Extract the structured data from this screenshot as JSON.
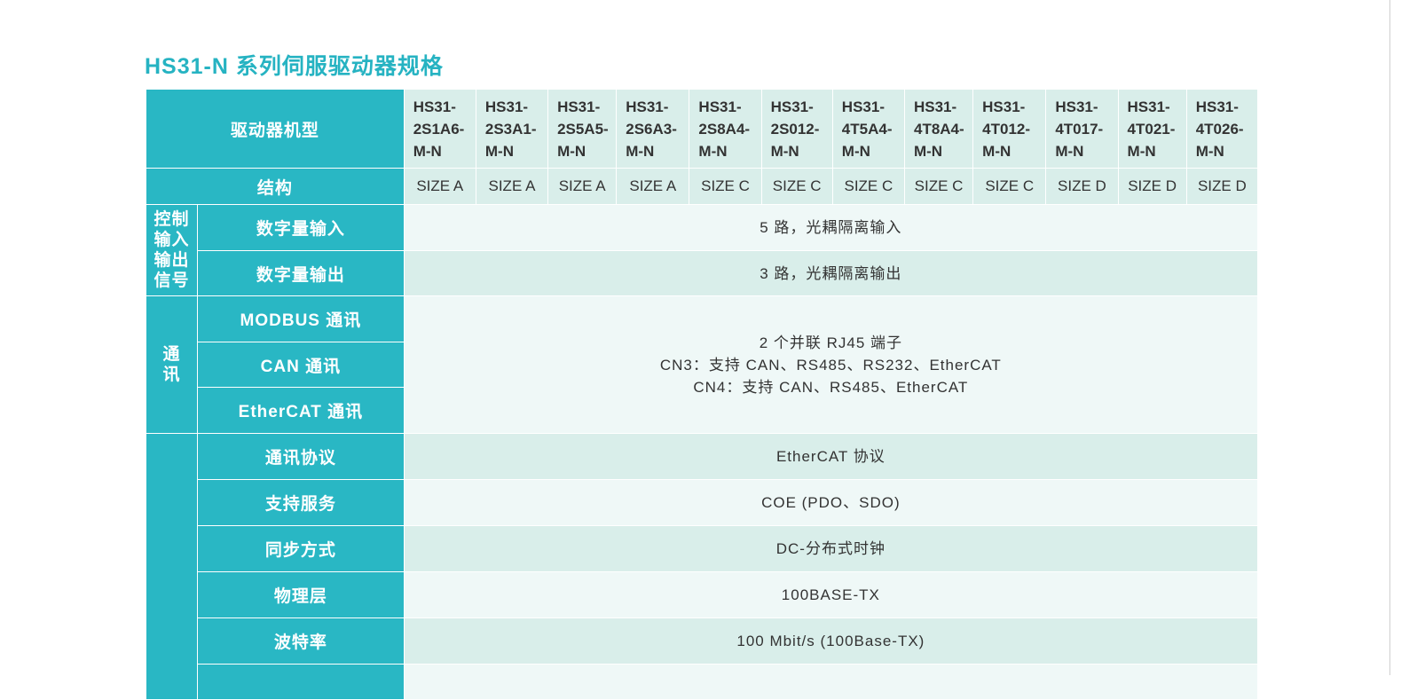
{
  "title": "HS31-N 系列伺服驱动器规格",
  "table": {
    "header_label": "驱动器机型",
    "models": [
      [
        "HS31-",
        "2S1A6-",
        "M-N"
      ],
      [
        "HS31-",
        "2S3A1-",
        "M-N"
      ],
      [
        "HS31-",
        "2S5A5-",
        "M-N"
      ],
      [
        "HS31-",
        "2S6A3-",
        "M-N"
      ],
      [
        "HS31-",
        "2S8A4-",
        "M-N"
      ],
      [
        "HS31-",
        "2S012-",
        "M-N"
      ],
      [
        "HS31-",
        "4T5A4-",
        "M-N"
      ],
      [
        "HS31-",
        "4T8A4-",
        "M-N"
      ],
      [
        "HS31-",
        "4T012-",
        "M-N"
      ],
      [
        "HS31-",
        "4T017-",
        "M-N"
      ],
      [
        "HS31-",
        "4T021-",
        "M-N"
      ],
      [
        "HS31-",
        "4T026-",
        "M-N"
      ]
    ],
    "structure_label": "结构",
    "sizes": [
      "SIZE A",
      "SIZE A",
      "SIZE A",
      "SIZE A",
      "SIZE C",
      "SIZE C",
      "SIZE C",
      "SIZE C",
      "SIZE C",
      "SIZE D",
      "SIZE D",
      "SIZE D"
    ],
    "io_group": {
      "lines": [
        "控制",
        "输入",
        "输出",
        "信号"
      ]
    },
    "digital_input": {
      "label": "数字量输入",
      "value": "5 路，光耦隔离输入"
    },
    "digital_output": {
      "label": "数字量输出",
      "value": "3 路，光耦隔离输出"
    },
    "comm_group": {
      "lines": [
        "通",
        "讯"
      ]
    },
    "modbus_label": "MODBUS 通讯",
    "can_label": "CAN 通讯",
    "ethercat_label": "EtherCAT 通讯",
    "comm_value": [
      "2 个并联 RJ45 端子",
      "CN3：支持 CAN、RS485、RS232、EtherCAT",
      "CN4：支持 CAN、RS485、EtherCAT"
    ],
    "ethercat_rows": [
      {
        "label": "通讯协议",
        "value": "EtherCAT 协议"
      },
      {
        "label": "支持服务",
        "value": "COE (PDO、SDO)"
      },
      {
        "label": "同步方式",
        "value": "DC-分布式时钟"
      },
      {
        "label": "物理层",
        "value": "100BASE-TX"
      },
      {
        "label": "波特率",
        "value": "100 Mbit/s (100Base-TX)"
      }
    ]
  }
}
